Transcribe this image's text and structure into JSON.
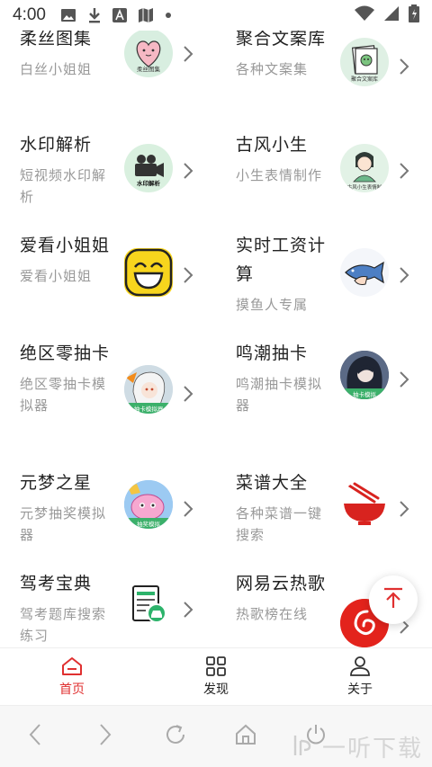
{
  "status_bar": {
    "time": "4:00",
    "icons": [
      "image-icon",
      "download-icon",
      "font-icon",
      "map-icon",
      "dot-icon",
      "wifi-icon",
      "signal-icon",
      "battery-icon"
    ]
  },
  "tools": [
    {
      "title": "柔丝图集",
      "desc": "白丝小姐姐",
      "icon": "silk-gallery-icon",
      "icon_label": "柔丝图集"
    },
    {
      "title": "聚合文案库",
      "desc": "各种文案集",
      "icon": "copywriting-icon",
      "icon_label": "聚合文案库"
    },
    {
      "title": "水印解析",
      "desc": "短视频水印解析",
      "icon": "watermark-parse-icon",
      "icon_label": "水印解析"
    },
    {
      "title": "古风小生",
      "desc": "小生表情制作",
      "icon": "ancient-style-icon",
      "icon_label": "古风小生表情制"
    },
    {
      "title": "爱看小姐姐",
      "desc": "爱看小姐姐",
      "icon": "laughing-face-icon"
    },
    {
      "title": "实时工资计算",
      "desc": "摸鱼人专属",
      "icon": "fish-icon"
    },
    {
      "title": "绝区零抽卡",
      "desc": "绝区零抽卡模拟器",
      "icon": "zzz-gacha-icon",
      "icon_label": "抽卡模拟器"
    },
    {
      "title": "鸣潮抽卡",
      "desc": "鸣潮抽卡模拟器",
      "icon": "wuthering-gacha-icon",
      "icon_label": "抽卡模拟"
    },
    {
      "title": "元梦之星",
      "desc": "元梦抽奖模拟器",
      "icon": "yuanmeng-icon",
      "icon_label": "抽奖模拟"
    },
    {
      "title": "菜谱大全",
      "desc": "各种菜谱一键搜索",
      "icon": "noodle-bowl-icon"
    },
    {
      "title": "驾考宝典",
      "desc": "驾考题库搜索练习",
      "icon": "driving-test-icon"
    },
    {
      "title": "网易云热歌",
      "desc": "热歌榜在线",
      "icon": "netease-music-icon"
    }
  ],
  "tabbar": {
    "tabs": [
      {
        "label": "首页",
        "icon": "home-icon",
        "active": true
      },
      {
        "label": "发现",
        "icon": "grid-icon",
        "active": false
      },
      {
        "label": "关于",
        "icon": "user-icon",
        "active": false
      }
    ]
  },
  "browser_nav": {
    "buttons": [
      "back-icon",
      "forward-icon",
      "refresh-icon",
      "home-icon",
      "power-icon"
    ]
  },
  "watermark": {
    "text": "一听下载"
  },
  "colors": {
    "accent": "#e03030",
    "text": "#222222",
    "muted": "#999999"
  }
}
